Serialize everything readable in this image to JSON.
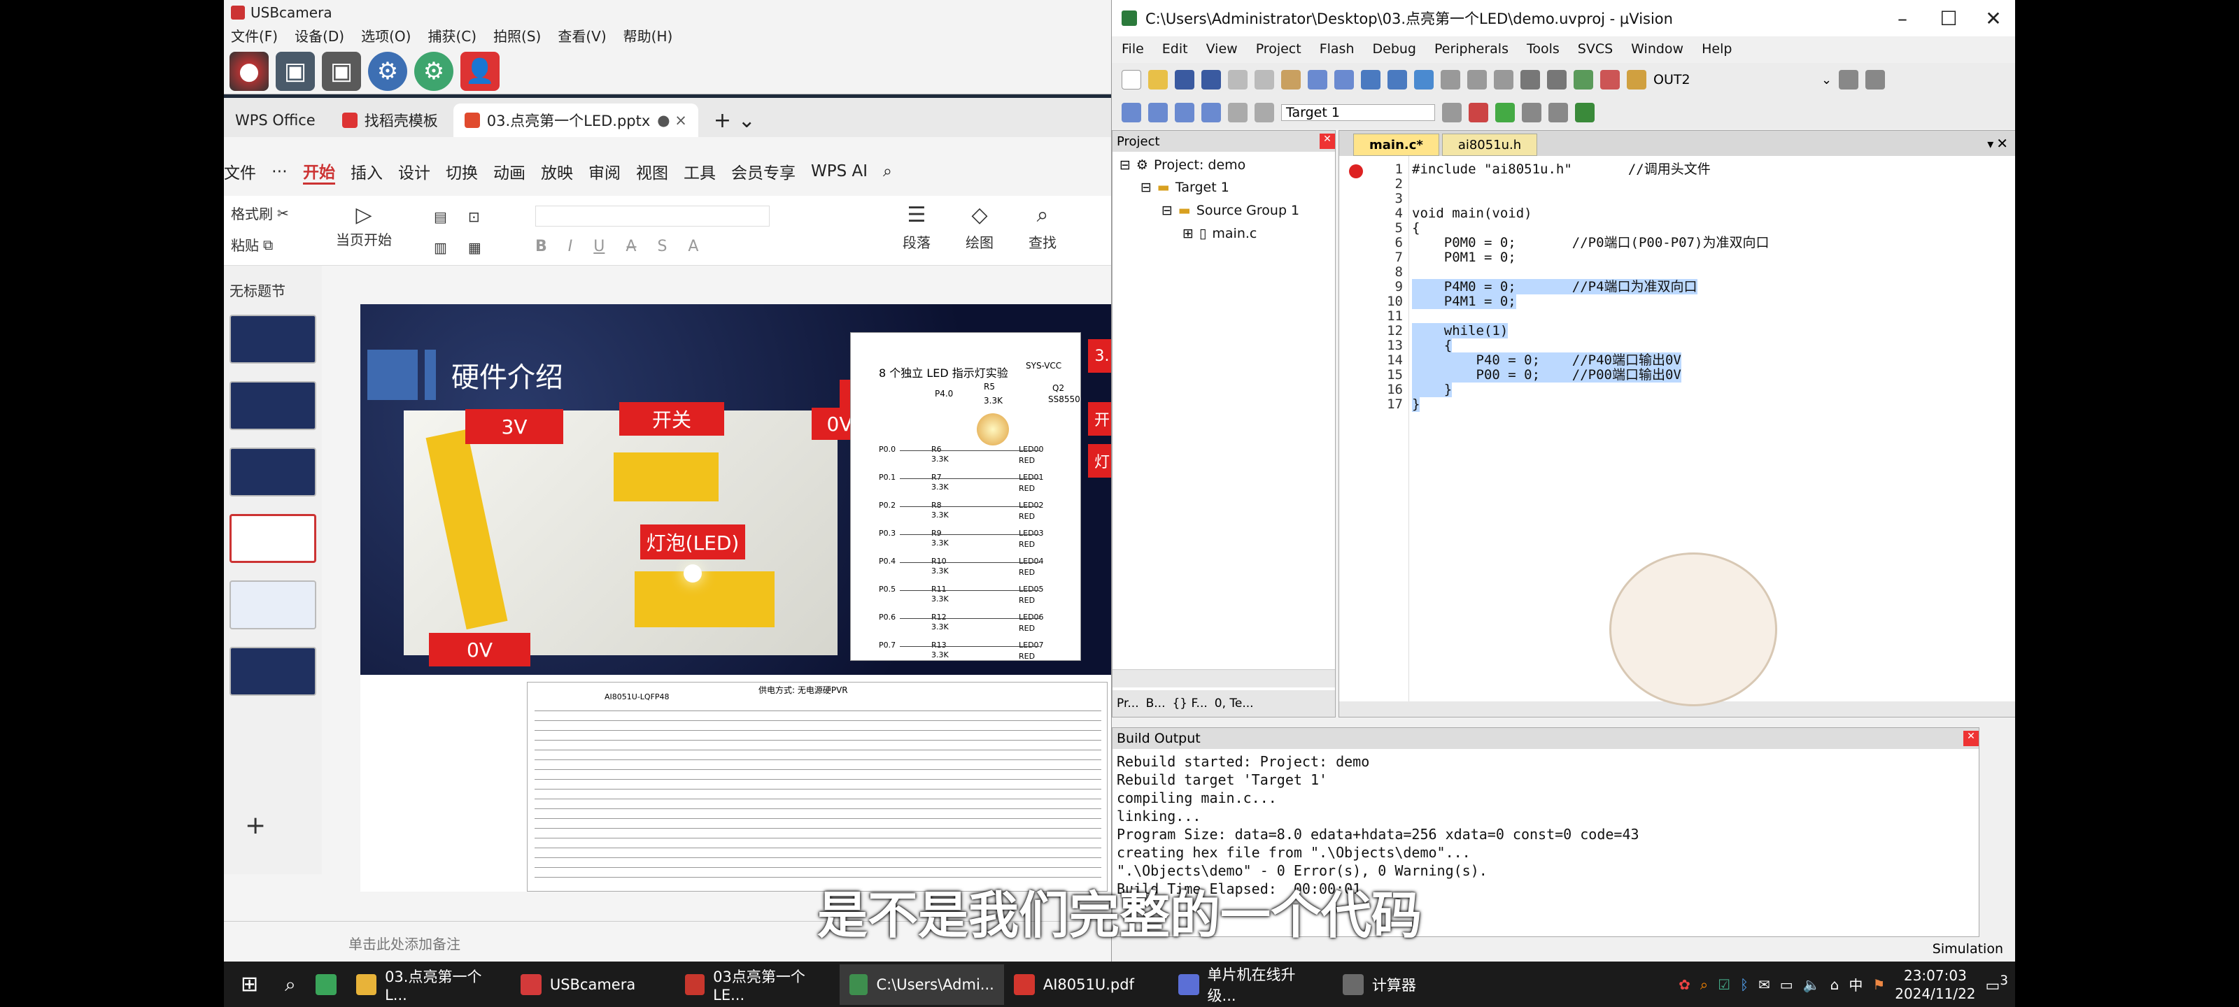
{
  "usbcamera": {
    "title": "USBcamera",
    "menu": [
      "文件(F)",
      "设备(D)",
      "选项(O)",
      "捕获(C)",
      "拍照(S)",
      "查看(V)",
      "帮助(H)"
    ]
  },
  "wps": {
    "tabs": [
      "WPS Office",
      "找稻壳模板",
      "03.点亮第一个LED.pptx"
    ],
    "ribbon_tabs": [
      "文件",
      "开始",
      "插入",
      "设计",
      "切换",
      "动画",
      "放映",
      "审阅",
      "视图",
      "工具",
      "会员专享",
      "WPS AI"
    ],
    "ribbon": {
      "format_painter": "格式刷",
      "paste": "粘贴",
      "from_current": "当页开始",
      "paragraph": "段落",
      "drawing": "绘图",
      "find": "查找"
    },
    "section": "无标题节",
    "notes_placeholder": "单击此处添加备注",
    "slide": {
      "title": "硬件介绍",
      "labels": {
        "l3v": "3V",
        "switch": "开关",
        "l0v_a": "0V",
        "l0v_b": "0V",
        "bulb": "灯泡(LED)",
        "l0v_c": "0V",
        "edge_3": "3.",
        "edge_kai": "开",
        "edge_deng": "灯"
      },
      "schematic_title": "8 个独立 LED 指示灯实验",
      "schematic": {
        "vcc": "SYS-VCC",
        "q": "Q2",
        "q_part": "SS8550",
        "r_top": "R5",
        "r_val": "3.3K",
        "p40": "P4.0",
        "rows": [
          {
            "pin": "P0.0",
            "r": "R6",
            "led": "LED00"
          },
          {
            "pin": "P0.1",
            "r": "R7",
            "led": "LED01"
          },
          {
            "pin": "P0.2",
            "r": "R8",
            "led": "LED02"
          },
          {
            "pin": "P0.3",
            "r": "R9",
            "led": "LED03"
          },
          {
            "pin": "P0.4",
            "r": "R10",
            "led": "LED04"
          },
          {
            "pin": "P0.5",
            "r": "R11",
            "led": "LED05"
          },
          {
            "pin": "P0.6",
            "r": "R12",
            "led": "LED06"
          },
          {
            "pin": "P0.7",
            "r": "R13",
            "led": "LED07"
          }
        ],
        "led_color": "RED"
      },
      "pinout_title": "供电方式: 无电源硬PVR",
      "pinout_chip": "AI8051U-LQFP48"
    }
  },
  "uvision": {
    "title": "C:\\Users\\Administrator\\Desktop\\03.点亮第一个LED\\demo.uvproj - µVision",
    "menu": [
      "File",
      "Edit",
      "View",
      "Project",
      "Flash",
      "Debug",
      "Peripherals",
      "Tools",
      "SVCS",
      "Window",
      "Help"
    ],
    "toolbar_output": "OUT2",
    "target_select": "Target 1",
    "project_panel": {
      "header": "Project",
      "items": [
        "Project: demo",
        "Target 1",
        "Source Group 1",
        "main.c"
      ],
      "bottom_tabs": [
        "Pr...",
        "B...",
        "{} F...",
        "0, Te..."
      ]
    },
    "editor_tabs": [
      "main.c*",
      "ai8051u.h"
    ],
    "code": [
      {
        "n": "1",
        "t": "#include \"ai8051u.h\"       //调用头文件"
      },
      {
        "n": "2",
        "t": ""
      },
      {
        "n": "3",
        "t": ""
      },
      {
        "n": "4",
        "t": "void main(void)"
      },
      {
        "n": "5",
        "t": "{"
      },
      {
        "n": "6",
        "t": "    P0M0 = 0;       //P0端口(P00-P07)为准双向口"
      },
      {
        "n": "7",
        "t": "    P0M1 = 0;"
      },
      {
        "n": "8",
        "t": ""
      },
      {
        "n": "9",
        "t": "    P4M0 = 0;       //P4端口为准双向口"
      },
      {
        "n": "10",
        "t": "    P4M1 = 0;"
      },
      {
        "n": "11",
        "t": ""
      },
      {
        "n": "12",
        "t": "    while(1)"
      },
      {
        "n": "13",
        "t": "    {"
      },
      {
        "n": "14",
        "t": "        P40 = 0;    //P40端口输出0V"
      },
      {
        "n": "15",
        "t": "        P00 = 0;    //P00端口输出0V"
      },
      {
        "n": "16",
        "t": "    }"
      },
      {
        "n": "17",
        "t": "}"
      }
    ],
    "build_output": {
      "header": "Build Output",
      "lines": [
        "Rebuild started: Project: demo",
        "Rebuild target 'Target 1'",
        "compiling main.c...",
        "linking...",
        "Program Size: data=8.0 edata+hdata=256 xdata=0 const=0 code=43",
        "creating hex file from \".\\Objects\\demo\"...",
        "\".\\Objects\\demo\" - 0 Error(s), 0 Warning(s).",
        "Build Time Elapsed:  00:00:01"
      ]
    },
    "status": "Simulation"
  },
  "subtitle": "是不是我们完整的一个代码",
  "taskbar": {
    "items": [
      {
        "label": "03.点亮第一个L...",
        "color": "#e8b339"
      },
      {
        "label": "USBcamera",
        "color": "#d33a3a"
      },
      {
        "label": "03点亮第一个LE...",
        "color": "#c8372d"
      },
      {
        "label": "C:\\Users\\Admi...",
        "color": "#3e8f4e"
      },
      {
        "label": "AI8051U.pdf",
        "color": "#d3362e"
      },
      {
        "label": "单片机在线升级...",
        "color": "#5b6fd6"
      },
      {
        "label": "计算器",
        "color": "#6a6a6a"
      }
    ],
    "ime": "中",
    "time": "23:07:03",
    "date": "2024/11/22",
    "notif_count": "3"
  }
}
